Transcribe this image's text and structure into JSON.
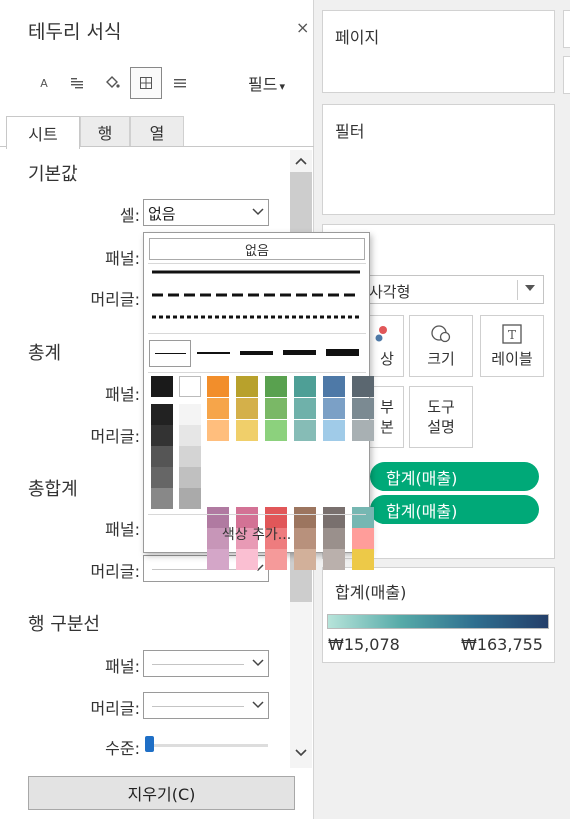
{
  "format_pane": {
    "title": "테두리 서식",
    "close_glyph": "×",
    "toolbar": [
      {
        "icon": "font-icon",
        "glyph": "A"
      },
      {
        "icon": "alignment-icon"
      },
      {
        "icon": "shading-icon"
      },
      {
        "icon": "borders-icon",
        "selected": true
      },
      {
        "icon": "lines-icon"
      }
    ],
    "fields_label": "필드",
    "tabs": [
      "시트",
      "행",
      "열"
    ],
    "active_tab": "시트",
    "sections": [
      {
        "title": "기본값",
        "rows": [
          {
            "label": "셀:",
            "value": "없음"
          },
          {
            "label": "패널:"
          },
          {
            "label": "머리글:"
          }
        ]
      },
      {
        "title": "총계",
        "rows": [
          {
            "label": "패널:"
          },
          {
            "label": "머리글:"
          }
        ]
      },
      {
        "title": "총합계",
        "rows": [
          {
            "label": "패널:"
          },
          {
            "label": "머리글:"
          }
        ]
      },
      {
        "title": "행 구분선",
        "rows": [
          {
            "label": "패널:"
          },
          {
            "label": "머리글:"
          }
        ]
      }
    ],
    "level_label": "수준:",
    "level_value": 0,
    "clear_button": "지우기(C)"
  },
  "border_popup": {
    "none_label": "없음",
    "line_styles": [
      "solid",
      "dashed",
      "dotted"
    ],
    "line_weights": [
      1,
      2,
      3,
      4,
      5
    ],
    "colors": {
      "black": "#1a1a1a",
      "white": "#ffffff",
      "grays": [
        "#222222",
        "#333333",
        "#555555",
        "#666666",
        "#888888"
      ],
      "light_grays": [
        "#f4f4f4",
        "#e6e6e6",
        "#d4d4d4",
        "#c0c0c0",
        "#aaaaaa"
      ],
      "palette": [
        [
          "#f28e2b",
          "#b8a12c",
          "#59a14f",
          "#4e9f96",
          "#4e79a7",
          "#5b6770"
        ],
        [
          "#f6a54a",
          "#d4b04a",
          "#7ab866",
          "#6fb1aa",
          "#7ba0c6",
          "#7b8a92"
        ],
        [
          "#ffbe7d",
          "#f0cf6a",
          "#8cd17d",
          "#86bcb6",
          "#a0cbe8",
          "#a8b0b3"
        ],
        [
          "#b07aa1",
          "#d37295",
          "#e15759",
          "#9c755f",
          "#79706e",
          "#76b7b2"
        ],
        [
          "#c796b8",
          "#e89ab5",
          "#ee7c7e",
          "#b8917c",
          "#9a908c",
          "#ff9d9a"
        ],
        [
          "#d4a6c8",
          "#fabfd2",
          "#f59a9a",
          "#d2b09a",
          "#bab0ac",
          "#edc948"
        ]
      ]
    },
    "add_color_label": "색상 추가..."
  },
  "pages_card": {
    "title": "페이지"
  },
  "filters_card": {
    "title": "필터"
  },
  "marks_card": {
    "mark_type": "사각형",
    "buttons": [
      {
        "label": "상",
        "icon": "color-icon"
      },
      {
        "label": "크기",
        "icon": "size-icon"
      },
      {
        "label": "레이블",
        "icon": "label-icon"
      },
      {
        "label": "부\n본",
        "icon": "detail-icon"
      },
      {
        "label": "도구\n설명",
        "icon": "tooltip-icon"
      }
    ],
    "pills": [
      "합계(매출)",
      "합계(매출)"
    ]
  },
  "legend": {
    "title": "합계(매출)",
    "min_label": "₩15,078",
    "max_label": "₩163,755",
    "colors": [
      "#b7e4da",
      "#56aaa8",
      "#2f6f8f",
      "#243f6a"
    ]
  }
}
